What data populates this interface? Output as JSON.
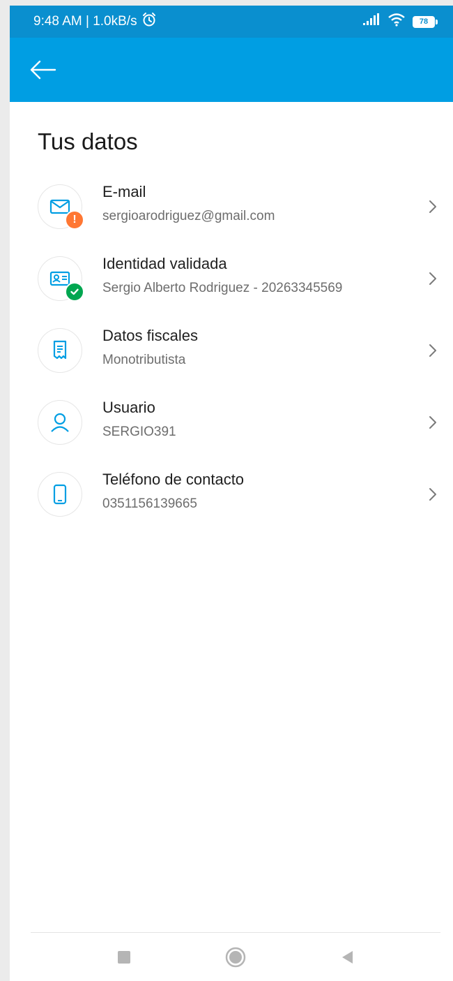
{
  "status_bar": {
    "time_speed": "9:48 AM | 1.0kB/s",
    "battery": "78",
    "icons": [
      "alarm-icon",
      "signal-icon",
      "wifi-icon",
      "battery-icon"
    ]
  },
  "app_bar": {
    "back_icon": "back-arrow-icon",
    "color": "#009ee3"
  },
  "page": {
    "title": "Tus datos"
  },
  "items": [
    {
      "title": "E-mail",
      "subtitle": "sergioarodriguez@gmail.com",
      "icon": "email-icon",
      "badge": "warning",
      "badge_color": "#ff7733"
    },
    {
      "title": "Identidad validada",
      "subtitle": "Sergio Alberto Rodriguez - 20263345569",
      "icon": "id-card-icon",
      "badge": "check",
      "badge_color": "#00a650"
    },
    {
      "title": "Datos fiscales",
      "subtitle": "Monotributista",
      "icon": "receipt-icon"
    },
    {
      "title": "Usuario",
      "subtitle": "SERGIO391",
      "icon": "user-icon"
    },
    {
      "title": "Teléfono de contacto",
      "subtitle": "0351156139665",
      "icon": "phone-icon"
    }
  ],
  "nav_bar": {
    "icons": [
      "recents-icon",
      "home-icon",
      "back-icon"
    ]
  },
  "colors": {
    "accent": "#009ee3",
    "status_bar": "#0a8fcf",
    "warning": "#ff7733",
    "success": "#00a650"
  }
}
